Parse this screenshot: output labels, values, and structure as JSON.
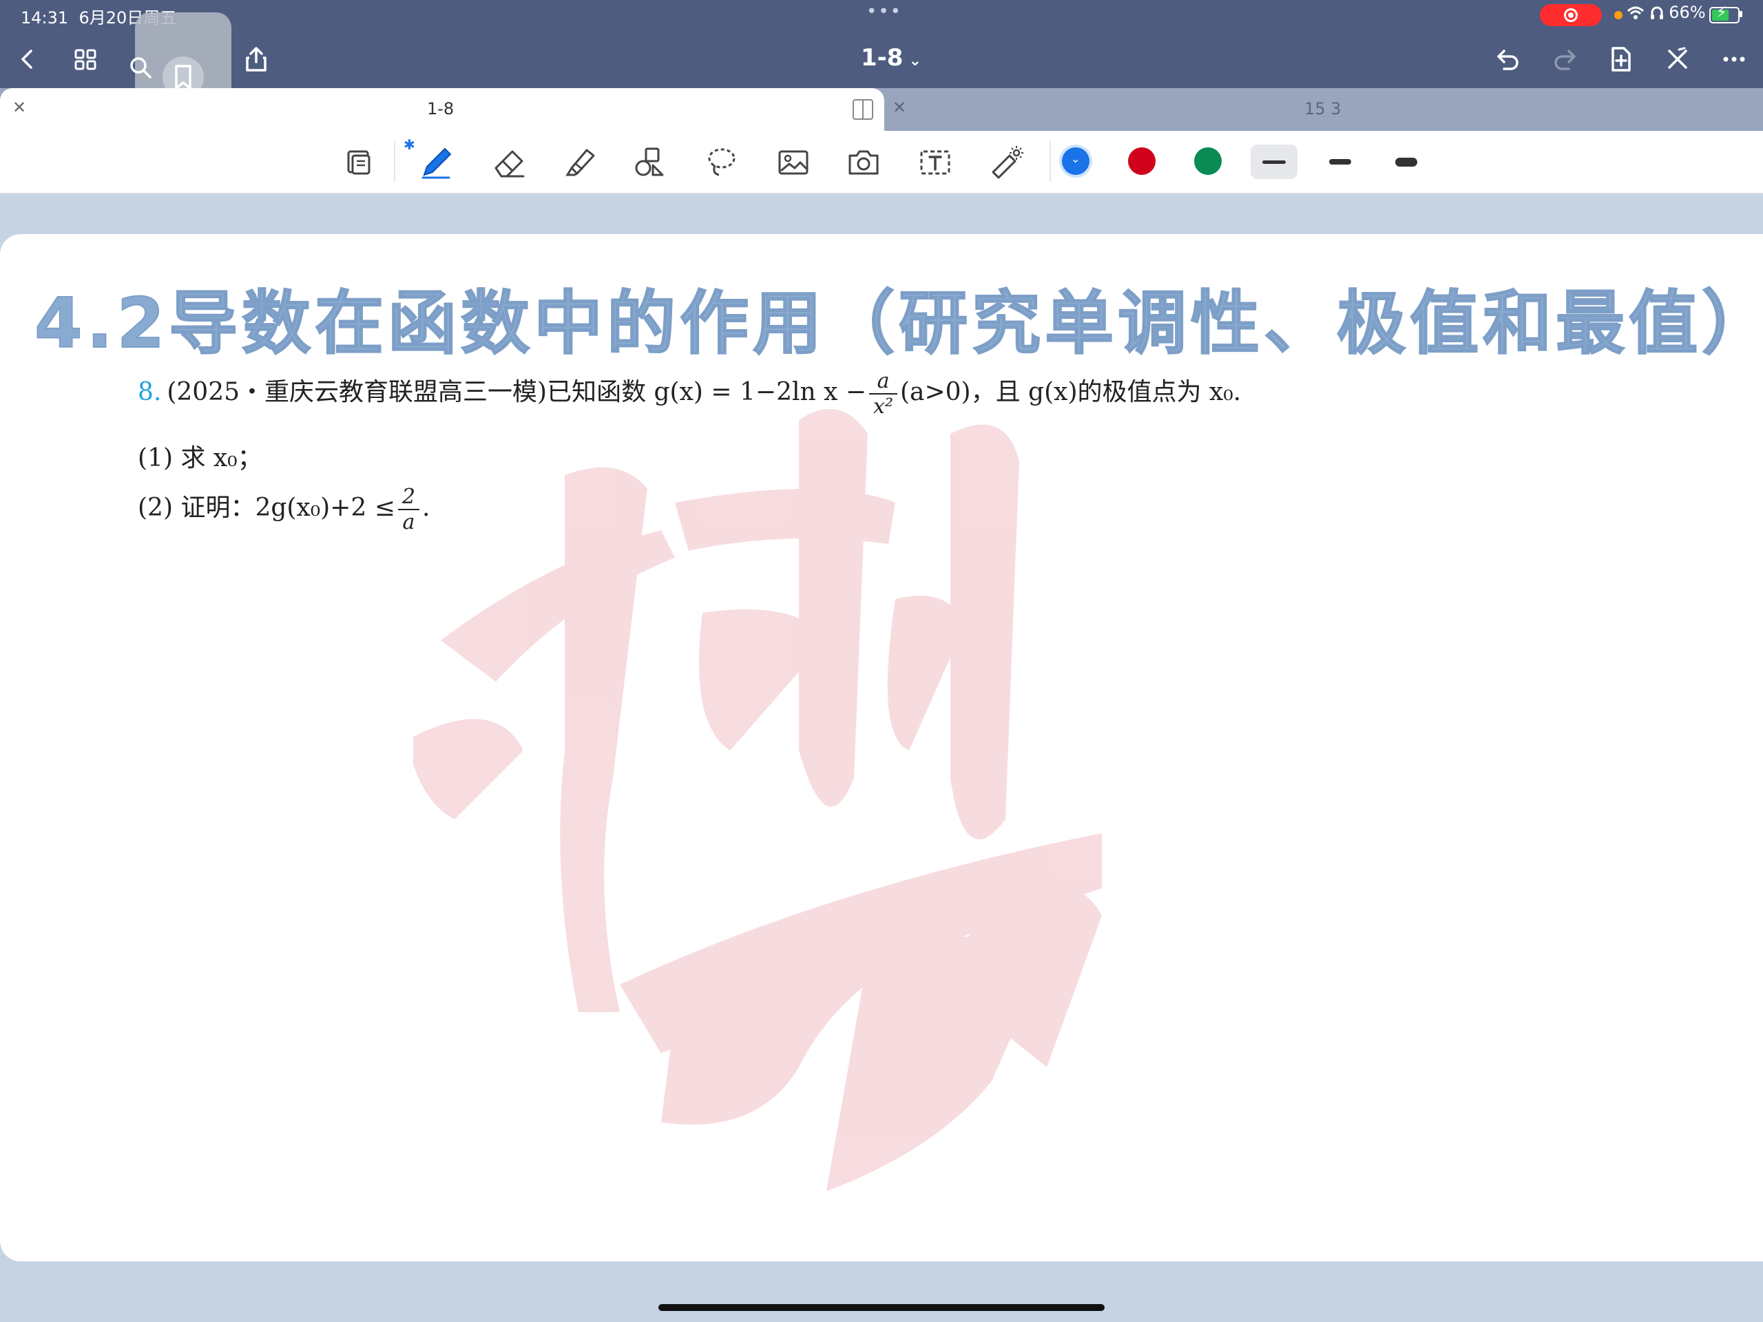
{
  "status": {
    "time": "14:31",
    "date": "6月20日周五",
    "battery": "66%",
    "colors": {
      "record": "#ff2d2d",
      "battery_fill": "#35c759",
      "dot": "#ff9f0a"
    }
  },
  "navbar": {
    "title": "1-8",
    "icons": [
      "chevron-left-icon",
      "grid-icon",
      "search-icon",
      "bookmark-icon",
      "share-icon",
      "undo-icon",
      "redo-icon",
      "add-page-icon",
      "close-icon",
      "more-icon"
    ]
  },
  "tabs": [
    {
      "label": "1-8",
      "active": true
    },
    {
      "label": "15 3",
      "active": false
    }
  ],
  "toolbar": {
    "tools": [
      "page-layout-icon",
      "pen-icon",
      "eraser-icon",
      "highlighter-icon",
      "shapes-icon",
      "lasso-icon",
      "image-icon",
      "camera-icon",
      "text-icon",
      "laser-pointer-icon"
    ],
    "colors": [
      "#1a73e8",
      "#d0021b",
      "#0a8a55"
    ],
    "thickness_selected": 1
  },
  "document": {
    "heading": "4.2导数在函数中的作用（研究单调性、极值和最值）",
    "problem": {
      "number": "8.",
      "text_pre": "(2025・重庆云教育联盟高三一模)已知函数 g(x) = 1−2ln x −",
      "frac_num": "a",
      "frac_den": "x²",
      "text_post": "(a>0)，且 g(x)的极值点为 x₀.",
      "part1": "(1) 求 x₀；",
      "part2_pre": "(2) 证明：2g(x₀)+2 ≤",
      "part2_frac_num": "2",
      "part2_frac_den": "a",
      "part2_post": "."
    }
  }
}
